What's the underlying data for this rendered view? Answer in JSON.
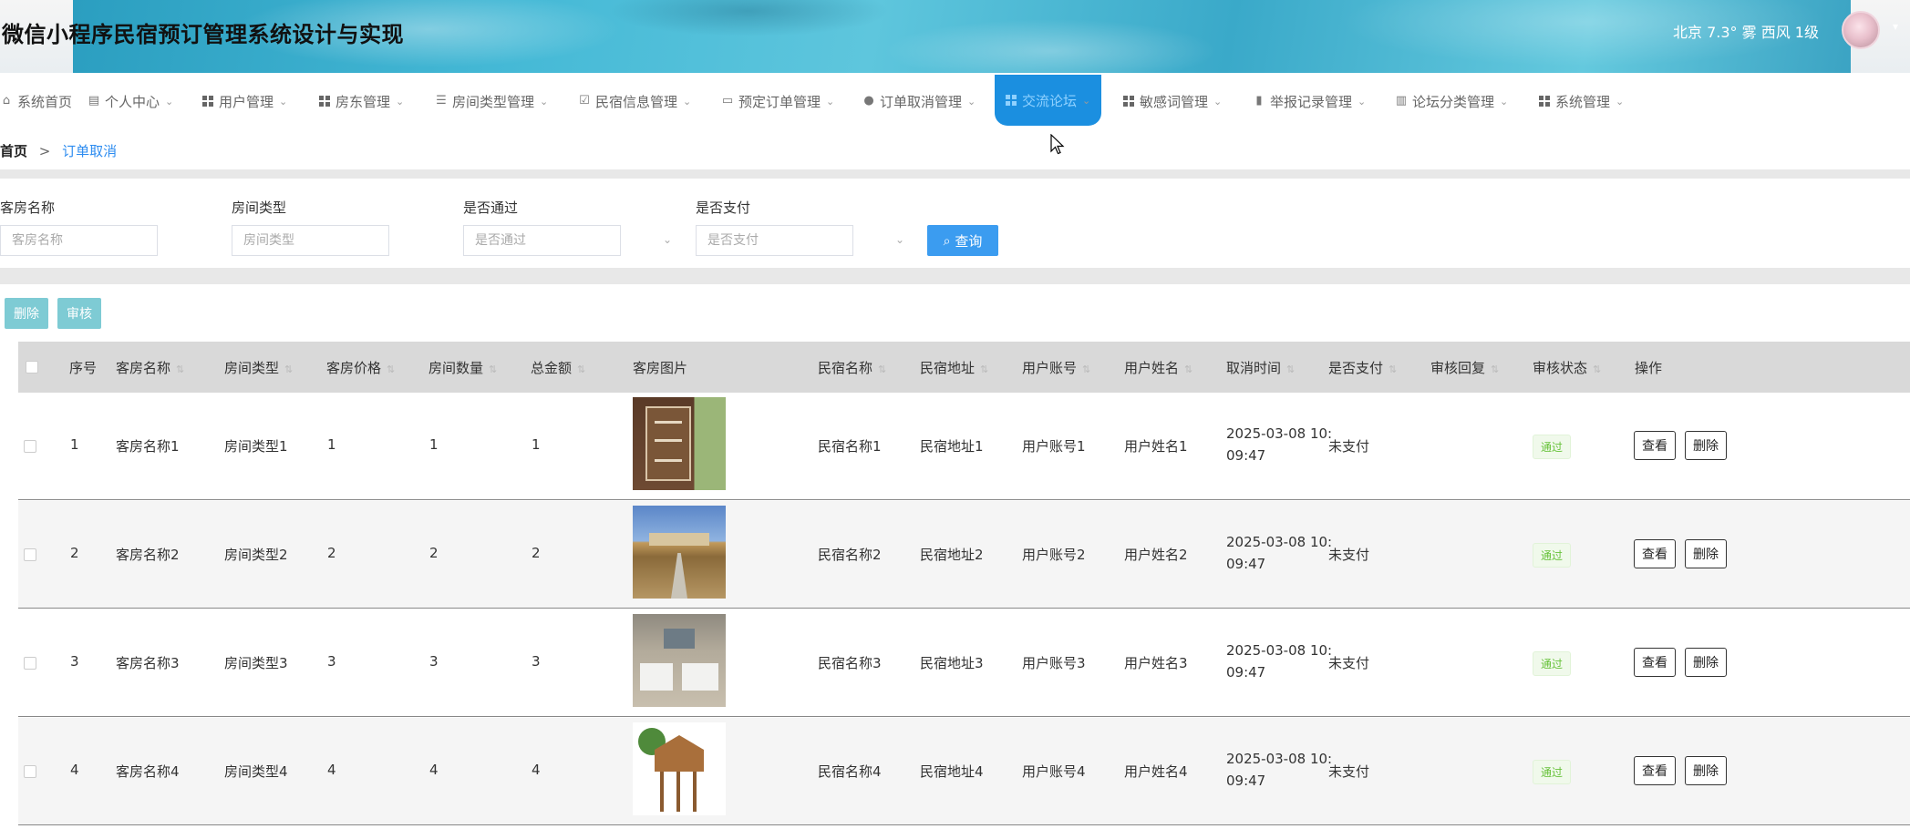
{
  "app": {
    "title": "微信小程序民宿预订管理系统设计与实现"
  },
  "header": {
    "weather": "北京  7.3°  雾  西风  1级"
  },
  "nav": {
    "items": [
      {
        "label": "系统首页",
        "icon": "home-icon"
      },
      {
        "label": "个人中心",
        "icon": "profile-icon"
      },
      {
        "label": "用户管理",
        "icon": "grid-icon"
      },
      {
        "label": "房东管理",
        "icon": "grid-icon"
      },
      {
        "label": "房间类型管理",
        "icon": "list-icon"
      },
      {
        "label": "民宿信息管理",
        "icon": "check-icon"
      },
      {
        "label": "预定订单管理",
        "icon": "monitor-icon"
      },
      {
        "label": "订单取消管理",
        "icon": "user-icon"
      },
      {
        "label": "交流论坛",
        "icon": "grid-icon"
      },
      {
        "label": "敏感词管理",
        "icon": "grid-icon"
      },
      {
        "label": "举报记录管理",
        "icon": "clipboard-icon"
      },
      {
        "label": "论坛分类管理",
        "icon": "chart-icon"
      },
      {
        "label": "系统管理",
        "icon": "grid-icon"
      }
    ]
  },
  "breadcrumb": {
    "home": "首页",
    "separator": ">",
    "current": "订单取消"
  },
  "search": {
    "fields": [
      {
        "label": "客房名称",
        "placeholder": "客房名称"
      },
      {
        "label": "房间类型",
        "placeholder": "房间类型"
      },
      {
        "label": "是否通过",
        "placeholder": "是否通过"
      },
      {
        "label": "是否支付",
        "placeholder": "是否支付"
      }
    ],
    "query_label": "查询"
  },
  "actions": {
    "delete_label": "删除",
    "audit_label": "审核"
  },
  "table": {
    "headers": [
      "序号",
      "客房名称",
      "房间类型",
      "客房价格",
      "房间数量",
      "总金额",
      "客房图片",
      "民宿名称",
      "民宿地址",
      "用户账号",
      "用户姓名",
      "取消时间",
      "是否支付",
      "审核回复",
      "审核状态",
      "操作"
    ],
    "view_label": "查看",
    "delete_label": "删除",
    "rows": [
      {
        "index": "1",
        "room_name": "客房名称1",
        "room_type": "房间类型1",
        "price": "1",
        "count": "1",
        "total": "1",
        "homestay_name": "民宿名称1",
        "homestay_addr": "民宿地址1",
        "account": "用户账号1",
        "user_name": "用户姓名1",
        "cancel_time_1": "2025-03-08 10:",
        "cancel_time_2": "09:47",
        "paid": "未支付",
        "reply": "",
        "status": "通过"
      },
      {
        "index": "2",
        "room_name": "客房名称2",
        "room_type": "房间类型2",
        "price": "2",
        "count": "2",
        "total": "2",
        "homestay_name": "民宿名称2",
        "homestay_addr": "民宿地址2",
        "account": "用户账号2",
        "user_name": "用户姓名2",
        "cancel_time_1": "2025-03-08 10:",
        "cancel_time_2": "09:47",
        "paid": "未支付",
        "reply": "",
        "status": "通过"
      },
      {
        "index": "3",
        "room_name": "客房名称3",
        "room_type": "房间类型3",
        "price": "3",
        "count": "3",
        "total": "3",
        "homestay_name": "民宿名称3",
        "homestay_addr": "民宿地址3",
        "account": "用户账号3",
        "user_name": "用户姓名3",
        "cancel_time_1": "2025-03-08 10:",
        "cancel_time_2": "09:47",
        "paid": "未支付",
        "reply": "",
        "status": "通过"
      },
      {
        "index": "4",
        "room_name": "客房名称4",
        "room_type": "房间类型4",
        "price": "4",
        "count": "4",
        "total": "4",
        "homestay_name": "民宿名称4",
        "homestay_addr": "民宿地址4",
        "account": "用户账号4",
        "user_name": "用户姓名4",
        "cancel_time_1": "2025-03-08 10:",
        "cancel_time_2": "09:47",
        "paid": "未支付",
        "reply": "",
        "status": "通过"
      }
    ]
  }
}
